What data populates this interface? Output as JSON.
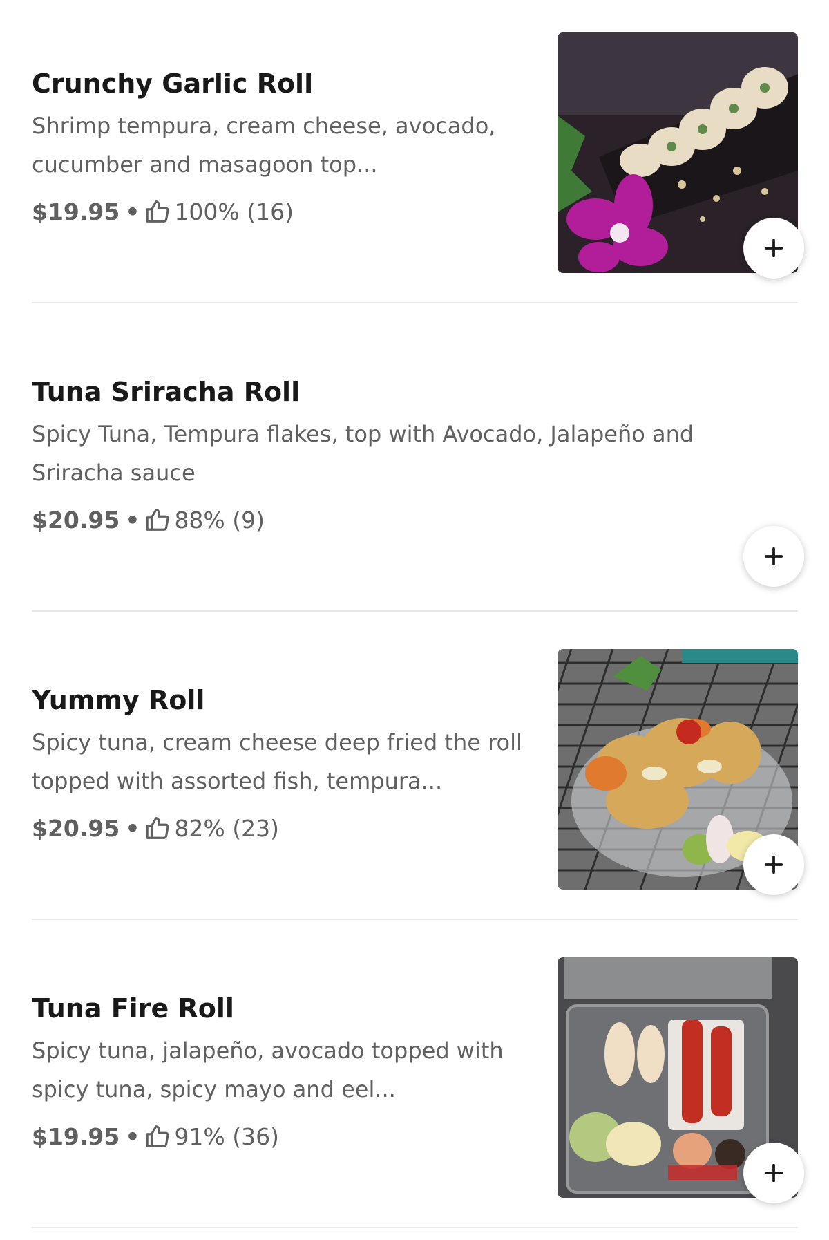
{
  "menu": {
    "items": [
      {
        "name": "Crunchy Garlic Roll",
        "description": "Shrimp tempura, cream cheese, avocado, cucumber and masagoon top...",
        "price": "$19.95",
        "separator": "•",
        "rating": "100% (16)",
        "has_photo": true,
        "photo_icon": "sushi-photo-icon",
        "add_icon": "plus-icon"
      },
      {
        "name": "Tuna Sriracha Roll",
        "description": "Spicy Tuna, Tempura flakes, top with Avocado, Jalapeño and Sriracha sauce",
        "price": "$20.95",
        "separator": "•",
        "rating": "88% (9)",
        "has_photo": false,
        "add_icon": "plus-icon"
      },
      {
        "name": "Yummy Roll",
        "description": "Spicy tuna, cream cheese deep fried the roll topped with assorted fish, tempura...",
        "price": "$20.95",
        "separator": "•",
        "rating": "82% (23)",
        "has_photo": true,
        "photo_icon": "sushi-photo-icon",
        "add_icon": "plus-icon"
      },
      {
        "name": "Tuna Fire Roll",
        "description": "Spicy tuna, jalapeño, avocado topped with spicy tuna, spicy mayo and eel...",
        "price": "$19.95",
        "separator": "•",
        "rating": "91% (36)",
        "has_photo": true,
        "photo_icon": "sushi-photo-icon",
        "add_icon": "plus-icon"
      }
    ]
  },
  "colors": {
    "title": "#191919",
    "secondary_text": "#606060",
    "divider": "#e8e8e8",
    "button_bg": "#ffffff"
  }
}
